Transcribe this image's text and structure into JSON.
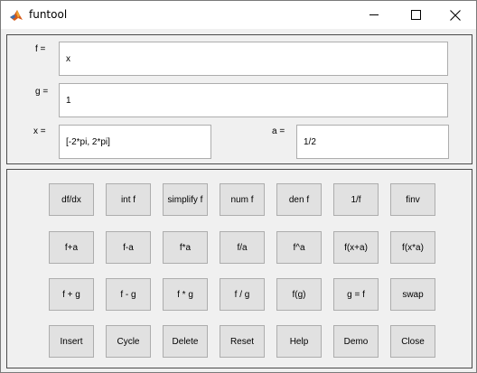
{
  "window": {
    "title": "funtool"
  },
  "fields": {
    "f": {
      "label": "f =",
      "value": "x"
    },
    "g": {
      "label": "g =",
      "value": "1"
    },
    "x": {
      "label": "x =",
      "value": "[-2*pi, 2*pi]"
    },
    "a": {
      "label": "a =",
      "value": "1/2"
    }
  },
  "buttons": [
    [
      "df/dx",
      "int f",
      "simplify f",
      "num f",
      "den f",
      "1/f",
      "finv"
    ],
    [
      "f+a",
      "f-a",
      "f*a",
      "f/a",
      "f^a",
      "f(x+a)",
      "f(x*a)"
    ],
    [
      "f + g",
      "f - g",
      "f * g",
      "f / g",
      "f(g)",
      "g = f",
      "swap"
    ],
    [
      "Insert",
      "Cycle",
      "Delete",
      "Reset",
      "Help",
      "Demo",
      "Close"
    ]
  ]
}
